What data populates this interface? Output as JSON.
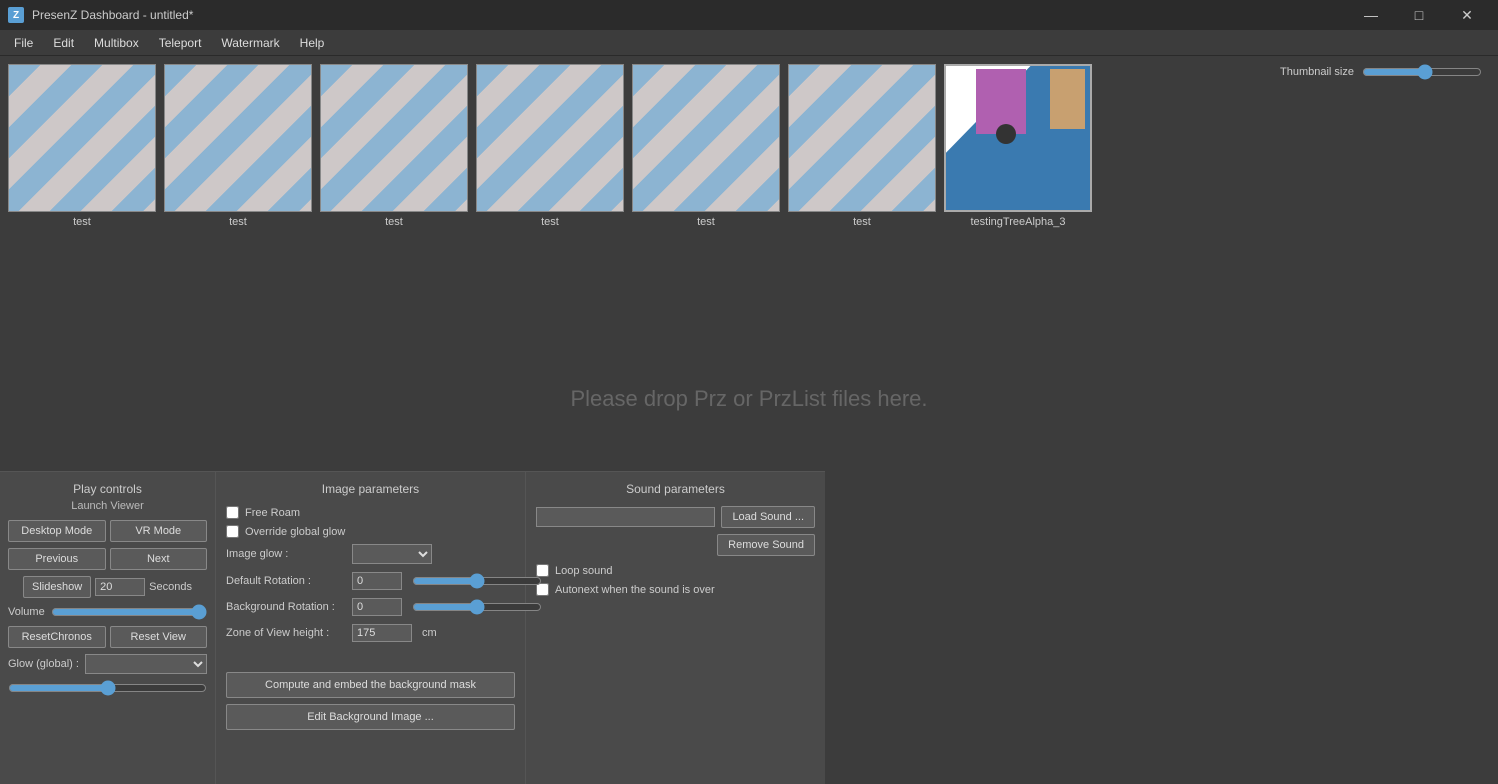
{
  "titleBar": {
    "icon": "Z",
    "title": "PresenZ Dashboard - untitled*",
    "minimizeLabel": "—",
    "maximizeLabel": "□",
    "closeLabel": "✕"
  },
  "menuBar": {
    "items": [
      "File",
      "Edit",
      "Multibox",
      "Teleport",
      "Watermark",
      "Help"
    ]
  },
  "thumbnailSizeLabel": "Thumbnail size",
  "thumbnails": [
    {
      "label": "test",
      "type": "stripe"
    },
    {
      "label": "test",
      "type": "stripe"
    },
    {
      "label": "test",
      "type": "stripe"
    },
    {
      "label": "test",
      "type": "stripe"
    },
    {
      "label": "test",
      "type": "stripe"
    },
    {
      "label": "test",
      "type": "stripe"
    },
    {
      "label": "testingTreeAlpha_3",
      "type": "special"
    }
  ],
  "dropZone": {
    "text": "Please drop Prz or PrzList files here."
  },
  "playControls": {
    "title": "Play controls",
    "subtitle": "Launch Viewer",
    "desktopMode": "Desktop Mode",
    "vrMode": "VR Mode",
    "previous": "Previous",
    "next": "Next",
    "slideshow": "Slideshow",
    "seconds": "20",
    "secondsLabel": "Seconds",
    "volumeLabel": "Volume",
    "resetChronos": "ResetChronos",
    "resetView": "Reset View",
    "glowLabel": "Glow (global) :"
  },
  "imageParams": {
    "title": "Image parameters",
    "freeRoamLabel": "Free Roam",
    "overrideGlobalGlowLabel": "Override global glow",
    "imageGlowLabel": "Image glow :",
    "defaultRotationLabel": "Default Rotation :",
    "defaultRotationValue": "0",
    "backgroundRotationLabel": "Background Rotation :",
    "backgroundRotationValue": "0",
    "zoneOfViewHeightLabel": "Zone of View height :",
    "zoneOfViewHeightValue": "175",
    "cmLabel": "cm",
    "computeEmbedLabel": "Compute and embed the background mask",
    "editBackgroundLabel": "Edit Background Image ..."
  },
  "soundParams": {
    "title": "Sound parameters",
    "loadSoundLabel": "Load Sound ...",
    "removeSoundLabel": "Remove Sound",
    "loopSoundLabel": "Loop sound",
    "autonextLabel": "Autonext when the sound is over"
  }
}
